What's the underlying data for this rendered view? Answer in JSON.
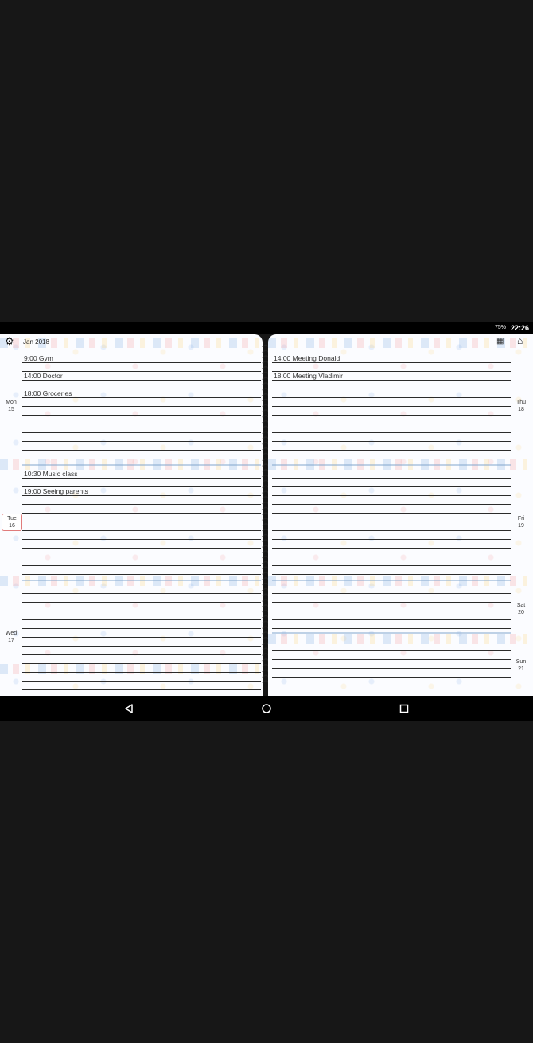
{
  "status_bar": {
    "battery": "75%",
    "time": "22:26"
  },
  "header": {
    "settings_icon": "gear-icon",
    "month": "Jan",
    "year": "2018",
    "calendar_icon": "calendar-icon",
    "home_icon": "home-icon"
  },
  "days": {
    "mon": {
      "name": "Mon",
      "num": "15"
    },
    "tue": {
      "name": "Tue",
      "num": "16"
    },
    "wed": {
      "name": "Wed",
      "num": "17"
    },
    "thu": {
      "name": "Thu",
      "num": "18"
    },
    "fri": {
      "name": "Fri",
      "num": "19"
    },
    "sat": {
      "name": "Sat",
      "num": "20"
    },
    "sun": {
      "name": "Sun",
      "num": "21"
    }
  },
  "events": {
    "mon": [
      "9:00 Gym",
      "14:00 Doctor",
      "18:00 Groceries"
    ],
    "tue": [
      "10:30 Music class",
      "19:00 Seeing parents"
    ],
    "thu": [
      "14:00 Meeting Donald",
      "18:00 Meeting Vladimir"
    ]
  },
  "nav_bar": {
    "back_icon": "back-triangle-icon",
    "home_icon": "home-circle-icon",
    "recents_icon": "recents-square-icon"
  }
}
